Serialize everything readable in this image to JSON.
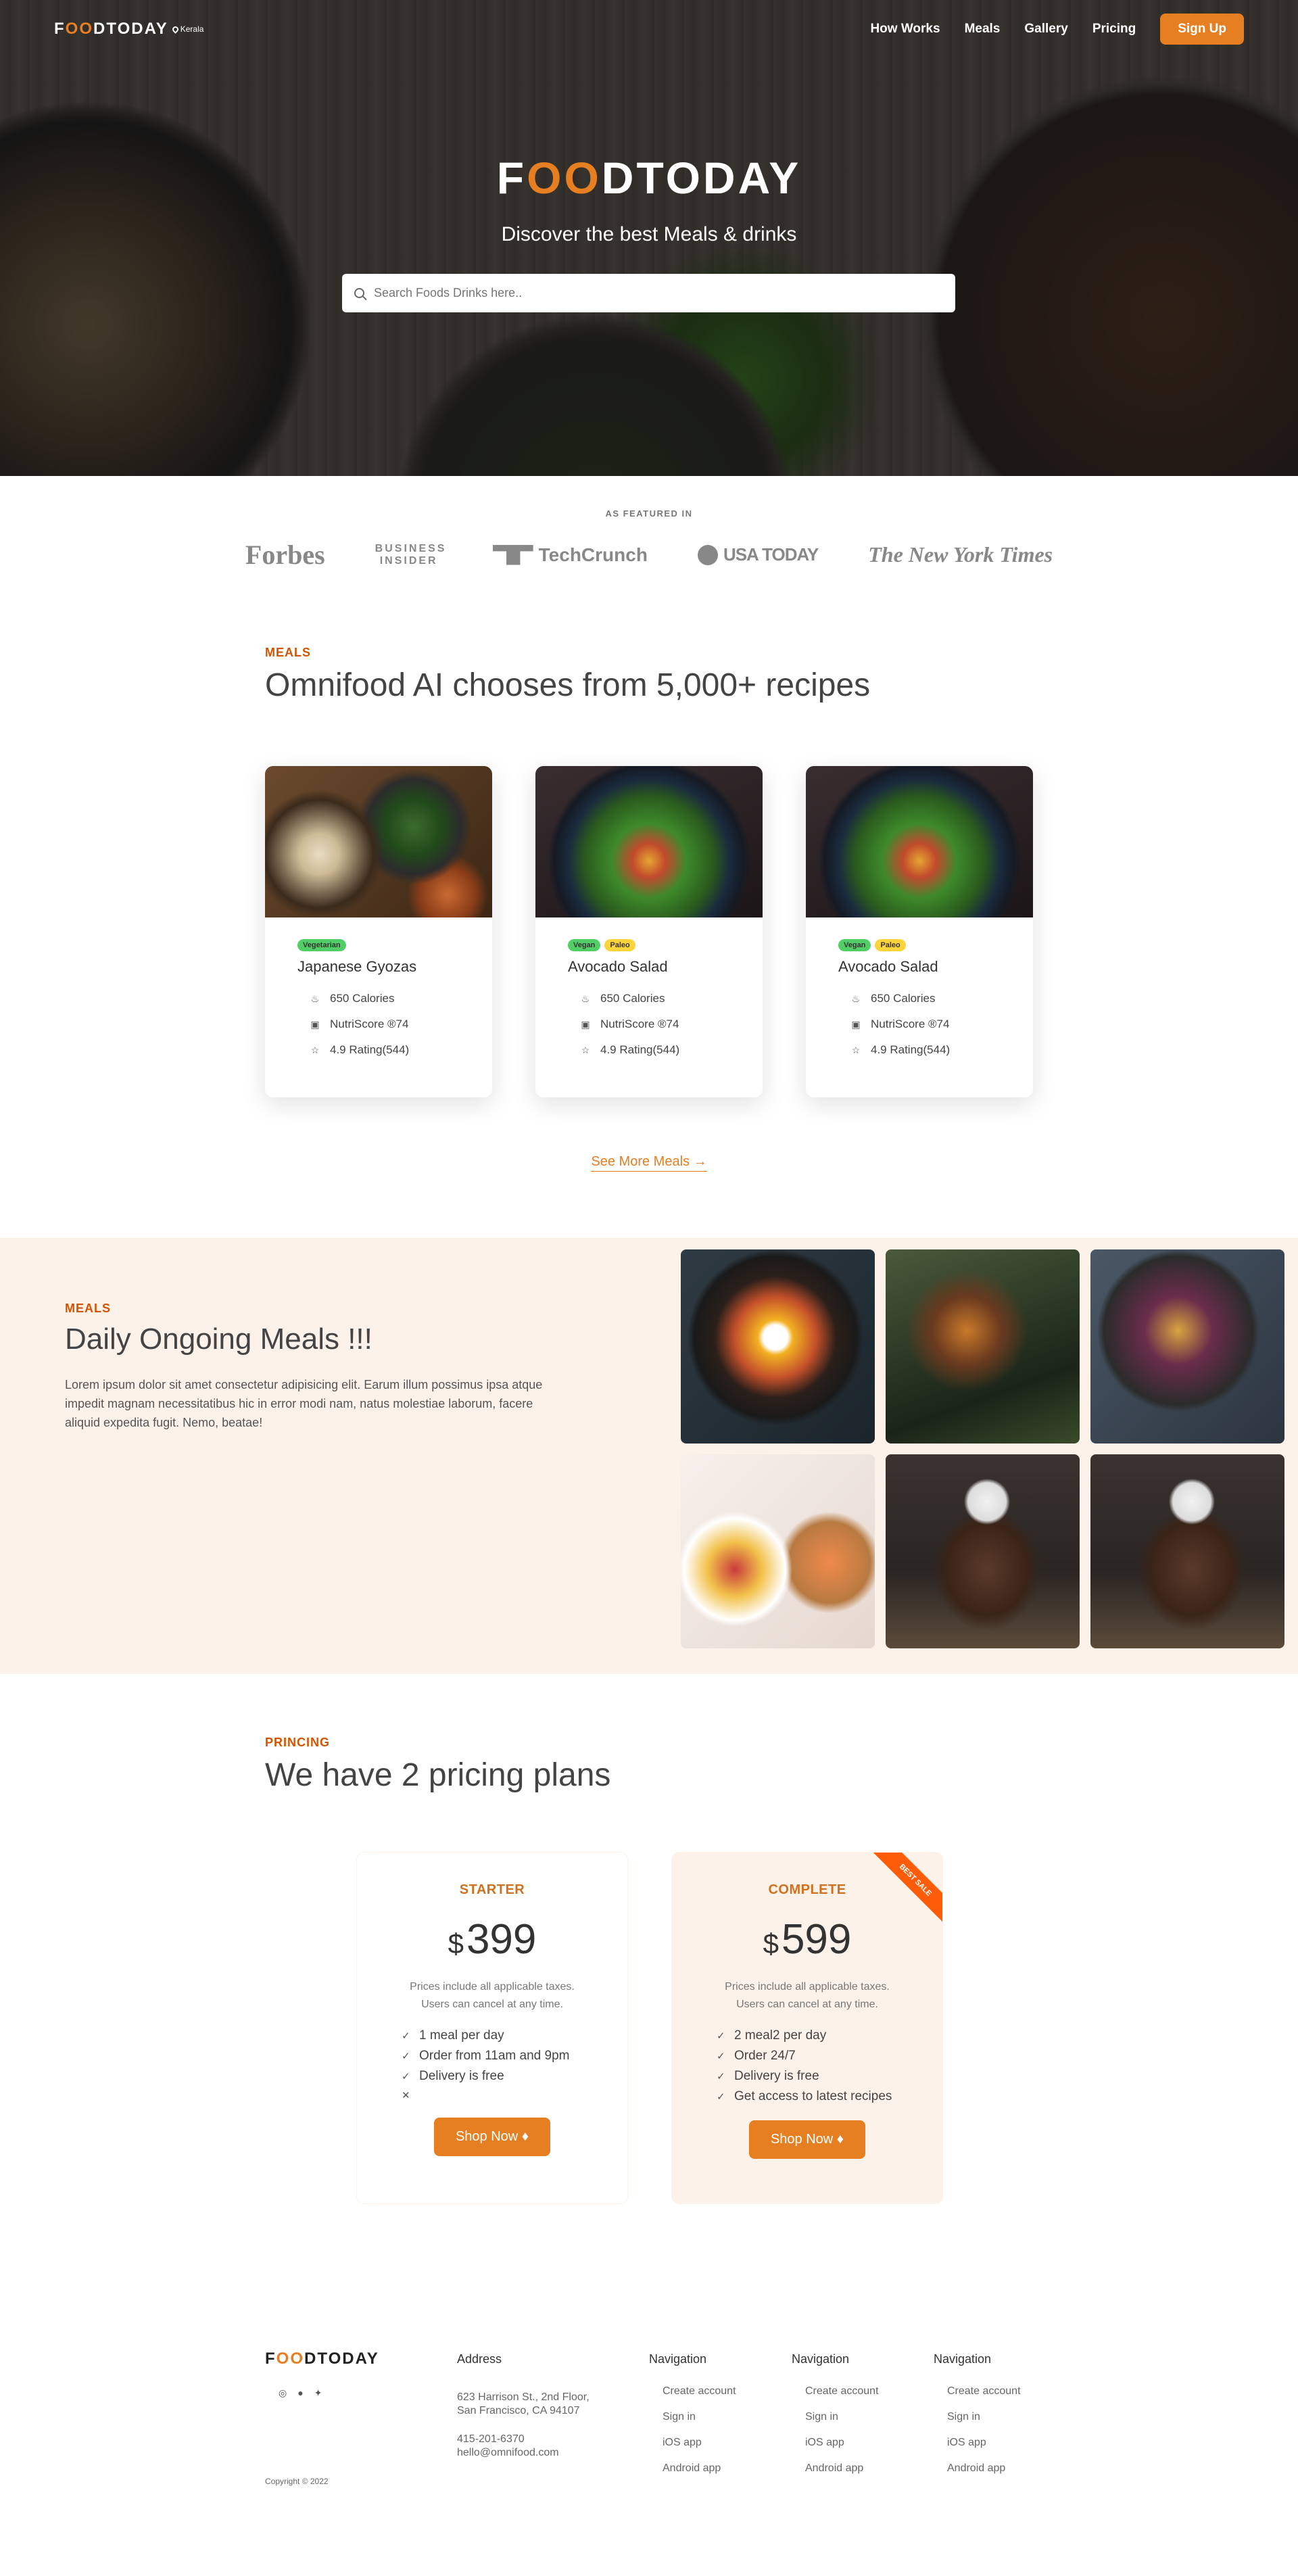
{
  "nav": {
    "logo": {
      "pre": "F",
      "oo": "OO",
      "post": "DTODAY"
    },
    "location": "Kerala",
    "links": [
      "How Works",
      "Meals",
      "Gallery",
      "Pricing"
    ],
    "signup": "Sign Up"
  },
  "hero": {
    "title": {
      "pre": "F",
      "oo": "OO",
      "post": "DTODAY"
    },
    "subtitle": "Discover the best Meals & drinks",
    "search_placeholder": "Search Foods Drinks here.."
  },
  "featured": {
    "label": "AS FEATURED IN",
    "logos": [
      "Forbes",
      "BUSINESS INSIDER",
      "TechCrunch",
      "USA TODAY",
      "The New York Times"
    ]
  },
  "meals": {
    "label": "MEALS",
    "title": "Omnifood AI chooses from 5,000+ recipes",
    "cards": [
      {
        "tags": [
          "Vegetarian"
        ],
        "title": "Japanese Gyozas",
        "calories": "650 Calories",
        "nutri": "NutriScore ®74",
        "rating": "4.9 Rating(544)"
      },
      {
        "tags": [
          "Vegan",
          "Paleo"
        ],
        "title": "Avocado Salad",
        "calories": "650 Calories",
        "nutri": "NutriScore ®74",
        "rating": "4.9 Rating(544)"
      },
      {
        "tags": [
          "Vegan",
          "Paleo"
        ],
        "title": "Avocado Salad",
        "calories": "650 Calories",
        "nutri": "NutriScore ®74",
        "rating": "4.9 Rating(544)"
      }
    ],
    "see_more": "See More Meals →"
  },
  "daily": {
    "label": "MEALS",
    "title": "Daily Ongoing Meals !!!",
    "text": "Lorem ipsum dolor sit amet consectetur adipisicing elit. Earum illum possimus ipsa atque impedit magnam necessitatibus hic in error modi nam, natus molestiae laborum, facere aliquid expedita fugit. Nemo, beatae!"
  },
  "pricing": {
    "label": "PRINCING",
    "title": "We have 2 pricing plans",
    "plans": [
      {
        "name": "STARTER",
        "currency": "$",
        "price": "399",
        "note1": "Prices include all applicable taxes.",
        "note2": "Users can cancel at any time.",
        "features": [
          "1 meal per day",
          "Order from 11am and 9pm",
          "Delivery is free",
          ""
        ],
        "feature_marks": [
          "✓",
          "✓",
          "✓",
          "✕"
        ],
        "button": "Shop Now ♦"
      },
      {
        "name": "COMPLETE",
        "currency": "$",
        "price": "599",
        "note1": "Prices include all applicable taxes.",
        "note2": "Users can cancel at any time.",
        "features": [
          "2 meal2 per day",
          "Order 24/7",
          "Delivery is free",
          "Get access to latest recipes"
        ],
        "feature_marks": [
          "✓",
          "✓",
          "✓",
          "✓"
        ],
        "button": "Shop Now ♦",
        "ribbon": "BEST SALE"
      }
    ]
  },
  "footer": {
    "logo": {
      "pre": "F",
      "oo": "OO",
      "post": "DTODAY"
    },
    "socials": [
      "instagram-icon",
      "facebook-icon",
      "twitter-icon"
    ],
    "copyright": "Copyright © 2022",
    "address": {
      "heading": "Address",
      "line1": "623 Harrison St., 2nd Floor,",
      "line2": "San Francisco, CA 94107",
      "phone": "415-201-6370",
      "email": "hello@omnifood.com"
    },
    "nav_cols": [
      {
        "heading": "Navigation",
        "links": [
          "Create account",
          "Sign in",
          "iOS app",
          "Android app"
        ]
      },
      {
        "heading": "Navigation",
        "links": [
          "Create account",
          "Sign in",
          "iOS app",
          "Android app"
        ]
      },
      {
        "heading": "Navigation",
        "links": [
          "Create account",
          "Sign in",
          "iOS app",
          "Android app"
        ]
      }
    ]
  },
  "colors": {
    "accent": "#e67e22",
    "accent_dark": "#cf711f",
    "cream": "#fdf2e9",
    "ribbon": "#ff5c0a"
  }
}
